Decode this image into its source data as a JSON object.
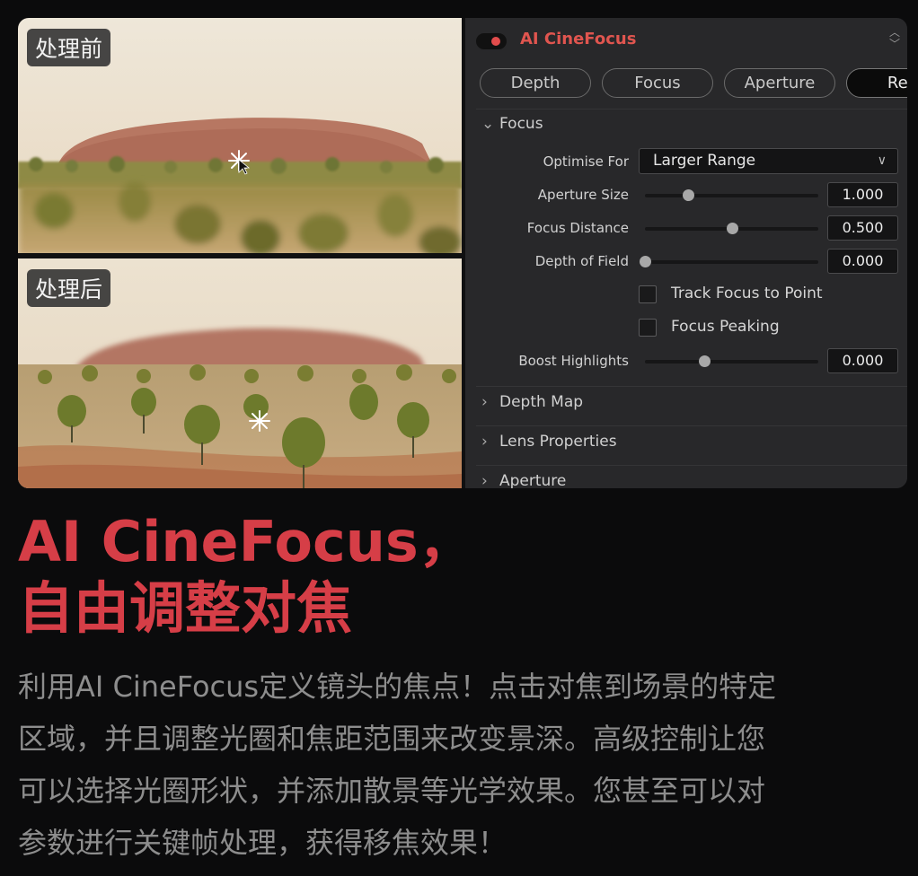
{
  "images": {
    "before_label": "处理前",
    "after_label": "处理后"
  },
  "plugin": {
    "title": "AI CineFocus",
    "accent_color": "#e0554f",
    "toggle_icon": "toggle-switch-icon",
    "reorder_icon": "up-down-chevron-icon"
  },
  "tabs": [
    {
      "label": "Depth",
      "active": false
    },
    {
      "label": "Focus",
      "active": false
    },
    {
      "label": "Aperture",
      "active": false
    },
    {
      "label": "Res",
      "active": true
    }
  ],
  "focus_section": {
    "title": "Focus",
    "expanded": true,
    "optimise_for": {
      "label": "Optimise For",
      "value": "Larger Range"
    },
    "aperture_size": {
      "label": "Aperture Size",
      "value": "1.000",
      "fraction": 0.25
    },
    "focus_distance": {
      "label": "Focus Distance",
      "value": "0.500",
      "fraction": 0.5
    },
    "depth_of_field": {
      "label": "Depth of Field",
      "value": "0.000",
      "fraction": 0.0
    },
    "track_focus": {
      "label": "Track Focus to Point",
      "checked": false
    },
    "focus_peaking": {
      "label": "Focus Peaking",
      "checked": false
    },
    "boost_highlights": {
      "label": "Boost Highlights",
      "value": "0.000",
      "fraction": 0.34
    }
  },
  "collapsed_sections": [
    {
      "title": "Depth Map"
    },
    {
      "title": "Lens Properties"
    },
    {
      "title": "Aperture"
    }
  ],
  "headline": {
    "line1": "AI CineFocus，",
    "line2": "自由调整对焦",
    "color": "#d63e47"
  },
  "body": {
    "lines": [
      "利用AI CineFocus定义镜头的焦点！点击对焦到场景的特定",
      "区域，并且调整光圈和焦距范围来改变景深。高级控制让您",
      "可以选择光圈形状，并添加散景等光学效果。您甚至可以对",
      "参数进行关键帧处理，获得移焦效果！"
    ]
  }
}
